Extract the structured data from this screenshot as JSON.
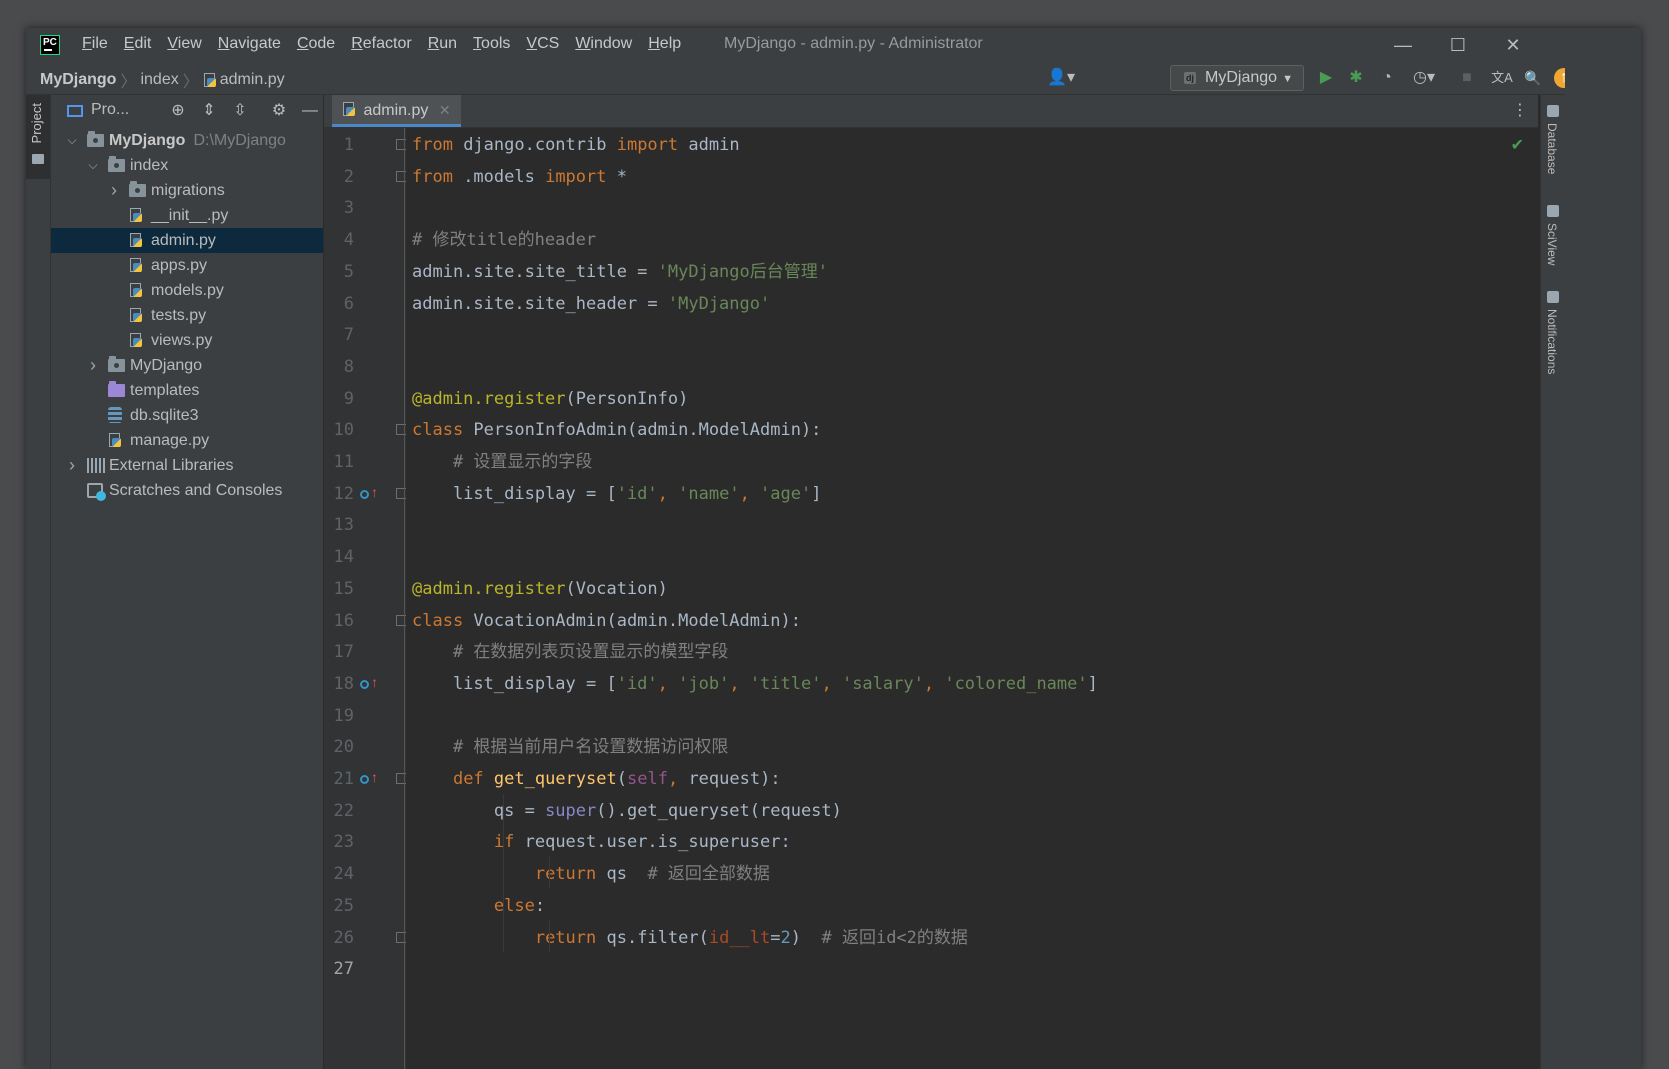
{
  "titlebar": {
    "logo_text": "PC",
    "menu": [
      {
        "label": "File",
        "mnemonic": "F",
        "rest": "ile"
      },
      {
        "label": "Edit",
        "mnemonic": "E",
        "rest": "dit"
      },
      {
        "label": "View",
        "mnemonic": "V",
        "rest": "iew"
      },
      {
        "label": "Navigate",
        "mnemonic": "N",
        "rest": "avigate"
      },
      {
        "label": "Code",
        "mnemonic": "C",
        "rest": "ode"
      },
      {
        "label": "Refactor",
        "mnemonic": "R",
        "rest": "efactor"
      },
      {
        "label": "Run",
        "mnemonic": "R",
        "rest": "un"
      },
      {
        "label": "Tools",
        "mnemonic": "T",
        "rest": "ools"
      },
      {
        "label": "VCS",
        "mnemonic": "V",
        "rest": "CS"
      },
      {
        "label": "Window",
        "mnemonic": "W",
        "rest": "indow"
      },
      {
        "label": "Help",
        "mnemonic": "H",
        "rest": "elp"
      }
    ],
    "window_title": "MyDjango - admin.py - Administrator",
    "controls": {
      "minimize": "—",
      "maximize": "☐",
      "close": "✕"
    }
  },
  "navbar": {
    "breadcrumb": {
      "project": "MyDjango",
      "folder": "index",
      "file": "admin.py",
      "sep": "〉"
    },
    "run_config": {
      "label": "MyDjango",
      "badge": "dj",
      "caret": "▼"
    },
    "icons": {
      "user": "👤▾",
      "run": "▶",
      "debug": "✱",
      "coverage": "◔",
      "profile": "◷▾",
      "stop": "■",
      "translate": "文A",
      "search": "🔍",
      "update": "↑",
      "jb": "◆"
    }
  },
  "left_stripe": {
    "project_tab": "Project"
  },
  "project_panel": {
    "title": "Pro...",
    "icons": {
      "locate": "⊕",
      "expand": "⇕",
      "collapse": "⇳",
      "settings": "⚙",
      "hide": "—"
    },
    "tree": [
      {
        "level": 0,
        "arrow": "v",
        "icon": "folder",
        "label": "MyDjango",
        "hint": "D:\\MyDjango",
        "bold": true
      },
      {
        "level": 1,
        "arrow": "v",
        "icon": "folder",
        "label": "index"
      },
      {
        "level": 2,
        "arrow": ">",
        "icon": "folder",
        "label": "migrations"
      },
      {
        "level": 2,
        "arrow": "",
        "icon": "py",
        "label": "__init__.py"
      },
      {
        "level": 2,
        "arrow": "",
        "icon": "py",
        "label": "admin.py",
        "selected": true
      },
      {
        "level": 2,
        "arrow": "",
        "icon": "py",
        "label": "apps.py"
      },
      {
        "level": 2,
        "arrow": "",
        "icon": "py",
        "label": "models.py"
      },
      {
        "level": 2,
        "arrow": "",
        "icon": "py",
        "label": "tests.py"
      },
      {
        "level": 2,
        "arrow": "",
        "icon": "py",
        "label": "views.py"
      },
      {
        "level": 1,
        "arrow": ">",
        "icon": "folder",
        "label": "MyDjango"
      },
      {
        "level": 1,
        "arrow": "",
        "icon": "folder-purple",
        "label": "templates"
      },
      {
        "level": 1,
        "arrow": "",
        "icon": "db",
        "label": "db.sqlite3"
      },
      {
        "level": 1,
        "arrow": "",
        "icon": "py",
        "label": "manage.py"
      },
      {
        "level": 0,
        "arrow": ">",
        "icon": "lib",
        "label": "External Libraries"
      },
      {
        "level": 0,
        "arrow": "",
        "icon": "scratch",
        "label": "Scratches and Consoles"
      }
    ]
  },
  "editor": {
    "tab": {
      "label": "admin.py",
      "close": "✕"
    },
    "more_icon": "⋮",
    "inspection": "✔",
    "current_line": 27,
    "lines": [
      [
        {
          "t": "from",
          "c": "kw"
        },
        {
          "t": " django.contrib "
        },
        {
          "t": "import",
          "c": "kw"
        },
        {
          "t": " admin"
        }
      ],
      [
        {
          "t": "from",
          "c": "kw"
        },
        {
          "t": " .models "
        },
        {
          "t": "import",
          "c": "kw"
        },
        {
          "t": " *"
        }
      ],
      [],
      [
        {
          "t": "# 修改title的header",
          "c": "cmt"
        }
      ],
      [
        {
          "t": "admin.site.site_title = "
        },
        {
          "t": "'MyDjango后台管理'",
          "c": "str"
        }
      ],
      [
        {
          "t": "admin.site.site_header = "
        },
        {
          "t": "'MyDjango'",
          "c": "str"
        }
      ],
      [],
      [],
      [
        {
          "t": "@admin.register",
          "c": "deco"
        },
        {
          "t": "(PersonInfo)"
        }
      ],
      [
        {
          "t": "class",
          "c": "kw"
        },
        {
          "t": " PersonInfoAdmin(admin.ModelAdmin):"
        }
      ],
      [
        {
          "t": "    "
        },
        {
          "t": "# 设置显示的字段",
          "c": "cmt"
        }
      ],
      [
        {
          "t": "    list_display = ["
        },
        {
          "t": "'id'",
          "c": "str"
        },
        {
          "t": ", ",
          "c": "kw"
        },
        {
          "t": "'name'",
          "c": "str"
        },
        {
          "t": ", ",
          "c": "kw"
        },
        {
          "t": "'age'",
          "c": "str"
        },
        {
          "t": "]"
        }
      ],
      [],
      [],
      [
        {
          "t": "@admin.register",
          "c": "deco"
        },
        {
          "t": "(Vocation)"
        }
      ],
      [
        {
          "t": "class",
          "c": "kw"
        },
        {
          "t": " VocationAdmin(admin.ModelAdmin):"
        }
      ],
      [
        {
          "t": "    "
        },
        {
          "t": "# 在数据列表页设置显示的模型字段",
          "c": "cmt"
        }
      ],
      [
        {
          "t": "    list_display = ["
        },
        {
          "t": "'id'",
          "c": "str"
        },
        {
          "t": ", ",
          "c": "kw"
        },
        {
          "t": "'job'",
          "c": "str"
        },
        {
          "t": ", ",
          "c": "kw"
        },
        {
          "t": "'title'",
          "c": "str"
        },
        {
          "t": ", ",
          "c": "kw"
        },
        {
          "t": "'salary'",
          "c": "str"
        },
        {
          "t": ", ",
          "c": "kw"
        },
        {
          "t": "'colored_name'",
          "c": "str"
        },
        {
          "t": "]"
        }
      ],
      [],
      [
        {
          "t": "    "
        },
        {
          "t": "# 根据当前用户名设置数据访问权限",
          "c": "cmt"
        }
      ],
      [
        {
          "t": "    "
        },
        {
          "t": "def",
          "c": "kw"
        },
        {
          "t": " "
        },
        {
          "t": "get_queryset",
          "c": "fn"
        },
        {
          "t": "("
        },
        {
          "t": "self",
          "c": "slf"
        },
        {
          "t": ", ",
          "c": "kw"
        },
        {
          "t": "request):"
        }
      ],
      [
        {
          "t": "        qs = "
        },
        {
          "t": "super",
          "c": "bi"
        },
        {
          "t": "().get_queryset(request)"
        }
      ],
      [
        {
          "t": "        "
        },
        {
          "t": "if",
          "c": "kw"
        },
        {
          "t": " request.user.is_superuser:"
        }
      ],
      [
        {
          "t": "            "
        },
        {
          "t": "return",
          "c": "kw"
        },
        {
          "t": " qs  "
        },
        {
          "t": "# 返回全部数据",
          "c": "cmt"
        }
      ],
      [
        {
          "t": "        "
        },
        {
          "t": "else",
          "c": "kw"
        },
        {
          "t": ":"
        }
      ],
      [
        {
          "t": "            "
        },
        {
          "t": "return",
          "c": "kw"
        },
        {
          "t": " qs.filter("
        },
        {
          "t": "id__lt",
          "c": "kwarg"
        },
        {
          "t": "="
        },
        {
          "t": "2",
          "c": "num"
        },
        {
          "t": ")  "
        },
        {
          "t": "# 返回id<2的数据",
          "c": "cmt"
        }
      ],
      []
    ],
    "override_markers": [
      12,
      18,
      21
    ],
    "fold_markers": [
      1,
      2,
      10,
      12,
      16,
      21,
      26
    ]
  },
  "right_stripe": {
    "items": [
      "Database",
      "SciView",
      "Notifications"
    ]
  }
}
